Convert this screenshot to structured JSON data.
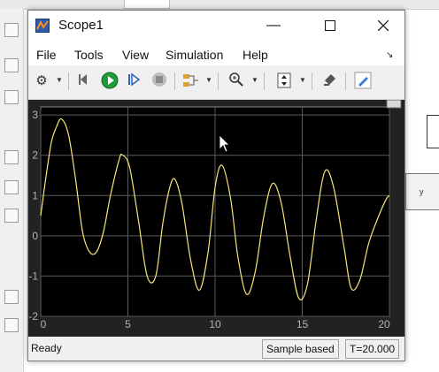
{
  "window": {
    "title": "Scope1"
  },
  "menu": [
    "File",
    "Tools",
    "View",
    "Simulation",
    "Help"
  ],
  "toolbar": {
    "icons": [
      "settings-icon",
      "step-back-icon",
      "run-icon",
      "step-forward-icon",
      "stop-icon",
      "signal-select-icon",
      "zoom-icon",
      "autoscale-icon",
      "highlight-icon",
      "edit-icon"
    ]
  },
  "status": {
    "ready": "Ready",
    "sample": "Sample based",
    "time": "T=20.000"
  },
  "background": {
    "block_label": "y"
  },
  "colors": {
    "plot_bg": "#000000",
    "panel_bg": "#222222",
    "trace": "#f7e67a",
    "grid": "#5a5a5a",
    "tick": "#b4b4b4"
  },
  "chart_data": {
    "type": "line",
    "title": "",
    "xlabel": "",
    "ylabel": "",
    "xlim": [
      0,
      20
    ],
    "ylim": [
      -2,
      3.2
    ],
    "x_ticks": [
      "0",
      "5",
      "10",
      "15",
      "20"
    ],
    "y_ticks": [
      "3",
      "2",
      "1",
      "0",
      "-1",
      "-2"
    ],
    "grid": true,
    "series": [
      {
        "x": [
          0,
          0.25,
          0.6,
          0.9,
          1.2,
          1.6,
          2.0,
          2.4,
          2.8,
          3.2,
          3.6,
          4.0,
          4.5,
          4.7,
          5.1,
          5.6,
          6.1,
          6.6,
          7.0,
          7.4,
          7.7,
          8.1,
          8.6,
          9.1,
          9.6,
          10.0,
          10.4,
          10.9,
          11.3,
          11.8,
          12.3,
          12.8,
          13.3,
          13.8,
          14.3,
          14.8,
          15.3,
          15.8,
          16.3,
          16.8,
          17.4,
          17.8,
          18.3,
          18.8,
          19.3,
          19.8,
          20.0
        ],
        "y": [
          0.5,
          1.3,
          2.3,
          2.7,
          2.9,
          2.5,
          1.4,
          0.1,
          -0.4,
          -0.4,
          0.1,
          1.0,
          1.9,
          2.0,
          1.7,
          0.4,
          -1.0,
          -1.0,
          0.3,
          1.2,
          1.4,
          0.8,
          -0.6,
          -1.35,
          -0.4,
          1.2,
          1.75,
          0.9,
          -0.5,
          -1.45,
          -0.9,
          0.5,
          1.3,
          0.8,
          -0.5,
          -1.55,
          -1.2,
          0.4,
          1.6,
          1.2,
          -0.3,
          -1.3,
          -1.1,
          -0.2,
          0.4,
          0.9,
          1.0
        ]
      }
    ]
  }
}
